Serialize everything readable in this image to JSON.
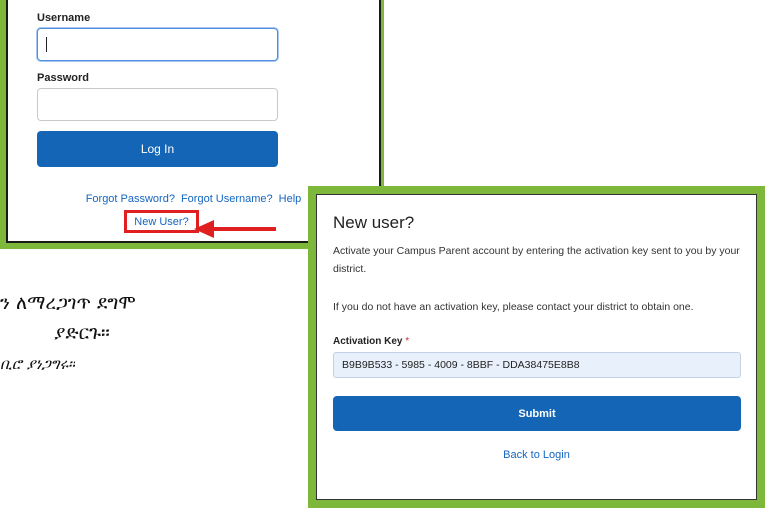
{
  "login": {
    "username_label": "Username",
    "username_value": "",
    "password_label": "Password",
    "password_value": "",
    "login_button": "Log In",
    "forgot_password": "Forgot Password?",
    "forgot_username": "Forgot Username?",
    "help": "Help",
    "new_user": "New User?"
  },
  "side_text": {
    "line1": "ን ለማረጋገጥ ደግሞ",
    "line2": "ያድርጉ።",
    "line3": "ቢሮ ያነጋግሩ።"
  },
  "new_user_panel": {
    "title": "New user?",
    "intro": "Activate your Campus Parent account by entering the activation key sent to you by your district.",
    "no_key": "If you do not have an activation key, please contact your district to obtain one.",
    "key_label": "Activation Key",
    "key_required_mark": "*",
    "key_value": "B9B9B533 - 5985 - 4009 - 8BBF - DDA38475E8B8",
    "submit_button": "Submit",
    "back_link": "Back to Login"
  },
  "colors": {
    "frame_green": "#7db83a",
    "primary_blue": "#1465b5",
    "link_blue": "#1565c0",
    "highlight_red": "#e02020"
  }
}
